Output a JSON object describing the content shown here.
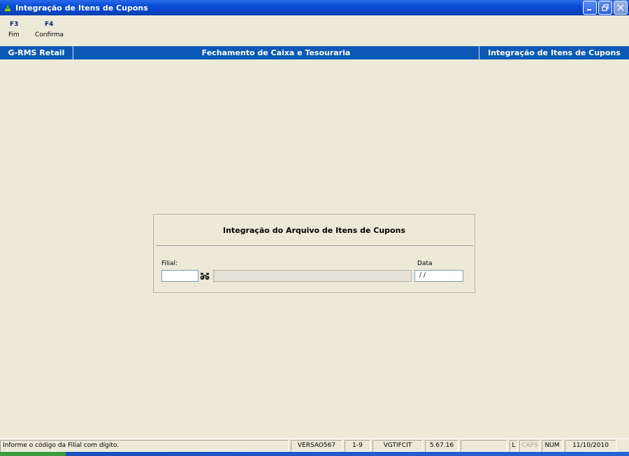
{
  "window": {
    "title": "Integração de Itens de Cupons"
  },
  "toolbar": {
    "items": [
      {
        "key": "F3",
        "label": "Fim"
      },
      {
        "key": "F4",
        "label": "Confirma"
      }
    ]
  },
  "header": {
    "left": "G-RMS Retail",
    "center": "Fechamento de Caixa e Tesouraria",
    "right": "Integração de Itens de Cupons"
  },
  "dialog": {
    "title": "Integração do Arquivo de Itens de Cupons",
    "filial_label": "Filial:",
    "filial_value": "",
    "filial_description": "",
    "data_label": "Data",
    "data_value": " / /"
  },
  "statusbar": {
    "message": "Informe o código da Filial com dígito.",
    "version": "VERSAO567",
    "code": "1-9",
    "program": "VGTIFCIT",
    "build": "5.67.16",
    "blank": "",
    "lock": "L",
    "caps": "CAPS",
    "num": "NUM",
    "date": "11/10/2010"
  },
  "colors": {
    "header_band": "#0b59b5",
    "window_bg": "#ece9d8",
    "titlebar": "#0b4fd8"
  }
}
